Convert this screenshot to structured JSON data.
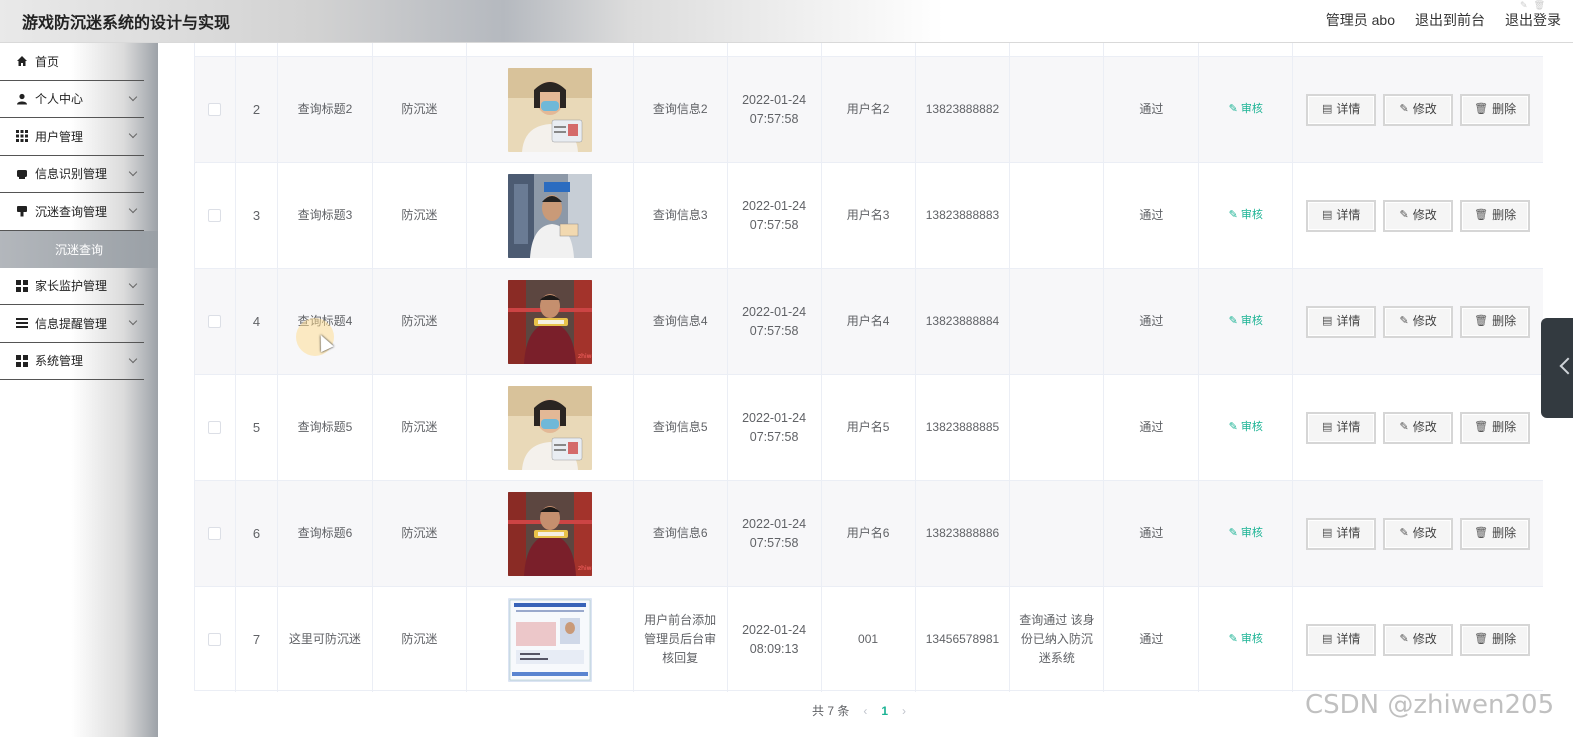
{
  "app": {
    "title": "游戏防沉迷系统的设计与实现"
  },
  "header": {
    "admin_label": "管理员 abo",
    "back_front": "退出到前台",
    "logout": "退出登录"
  },
  "sidebar": {
    "items": [
      {
        "label": "首页",
        "icon": "home-icon"
      },
      {
        "label": "个人中心",
        "icon": "user-icon"
      },
      {
        "label": "用户管理",
        "icon": "grid-icon"
      },
      {
        "label": "信息识别管理",
        "icon": "card-icon"
      },
      {
        "label": "沉迷查询管理",
        "icon": "flag-icon"
      },
      {
        "label": "家长监护管理",
        "icon": "grid-icon"
      },
      {
        "label": "信息提醒管理",
        "icon": "list-icon"
      },
      {
        "label": "系统管理",
        "icon": "grid-icon"
      }
    ],
    "submenu_label": "沉迷查询"
  },
  "table": {
    "rows": [
      {
        "no": "2",
        "title": "查询标题2",
        "type": "防沉迷",
        "info": "查询信息2",
        "time": "2022-01-24 07:57:58",
        "user": "用户名2",
        "phone": "13823888882",
        "reply": "",
        "status": "通过",
        "audit": "审核",
        "photo": "woman-mask"
      },
      {
        "no": "3",
        "title": "查询标题3",
        "type": "防沉迷",
        "info": "查询信息3",
        "time": "2022-01-24 07:57:58",
        "user": "用户名3",
        "phone": "13823888883",
        "reply": "",
        "status": "通过",
        "audit": "审核",
        "photo": "man-office"
      },
      {
        "no": "4",
        "title": "查询标题4",
        "type": "防沉迷",
        "info": "查询信息4",
        "time": "2022-01-24 07:57:58",
        "user": "用户名4",
        "phone": "13823888884",
        "reply": "",
        "status": "通过",
        "audit": "审核",
        "photo": "man-red"
      },
      {
        "no": "5",
        "title": "查询标题5",
        "type": "防沉迷",
        "info": "查询信息5",
        "time": "2022-01-24 07:57:58",
        "user": "用户名5",
        "phone": "13823888885",
        "reply": "",
        "status": "通过",
        "audit": "审核",
        "photo": "woman-mask"
      },
      {
        "no": "6",
        "title": "查询标题6",
        "type": "防沉迷",
        "info": "查询信息6",
        "time": "2022-01-24 07:57:58",
        "user": "用户名6",
        "phone": "13823888886",
        "reply": "",
        "status": "通过",
        "audit": "审核",
        "photo": "man-red"
      },
      {
        "no": "7",
        "title": "这里可防沉迷",
        "type": "防沉迷",
        "info": "用户前台添加管理员后台审核回复",
        "time": "2022-01-24 08:09:13",
        "user": "001",
        "phone": "13456578981",
        "reply": "查询通过 该身份已纳入防沉迷系统",
        "status": "通过",
        "audit": "审核",
        "photo": "id-card"
      }
    ],
    "ops": {
      "detail": "详情",
      "edit": "修改",
      "delete": "删除"
    }
  },
  "pagination": {
    "total_label": "共 7 条",
    "current": "1"
  },
  "watermark": "CSDN @zhiwen205",
  "colors": {
    "accent": "#1bb394",
    "text": "#606266"
  }
}
